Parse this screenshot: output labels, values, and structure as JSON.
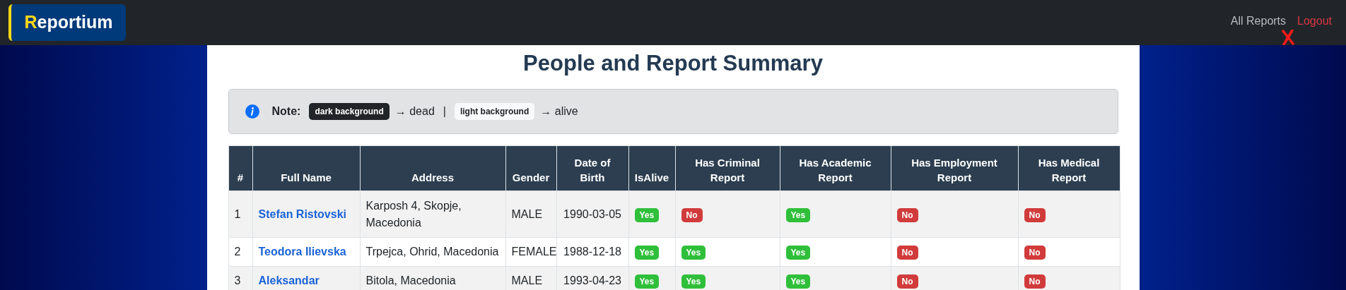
{
  "navbar": {
    "logo_first": "R",
    "logo_rest": "eportium",
    "links": [
      {
        "label": "All Reports",
        "kind": "normal"
      },
      {
        "label": "Logout",
        "kind": "danger"
      }
    ]
  },
  "title": "People and Report Summary",
  "note": {
    "label": "Note:",
    "dark_badge": "dark background",
    "dark_meaning": "→ dead",
    "separator": "|",
    "light_badge": "light background",
    "light_meaning": "→ alive"
  },
  "table": {
    "columns": [
      "#",
      "Full Name",
      "Address",
      "Gender",
      "Date of Birth",
      "IsAlive",
      "Has Criminal Report",
      "Has Academic Report",
      "Has Employment Report",
      "Has Medical Report"
    ],
    "rows": [
      {
        "index": "1",
        "name": "Stefan Ristovski",
        "address": "Karposh 4, Skopje, Macedonia",
        "gender": "MALE",
        "dob": "1990-03-05",
        "flags": [
          {
            "label": "Yes",
            "positive": true
          },
          {
            "label": "No",
            "positive": false
          },
          {
            "label": "Yes",
            "positive": true
          },
          {
            "label": "No",
            "positive": false
          },
          {
            "label": "No",
            "positive": false
          }
        ]
      },
      {
        "index": "2",
        "name": "Teodora Ilievska",
        "address": "Trpejca, Ohrid, Macedonia",
        "gender": "FEMALE",
        "dob": "1988-12-18",
        "flags": [
          {
            "label": "Yes",
            "positive": true
          },
          {
            "label": "Yes",
            "positive": true
          },
          {
            "label": "Yes",
            "positive": true
          },
          {
            "label": "No",
            "positive": false
          },
          {
            "label": "No",
            "positive": false
          }
        ]
      },
      {
        "index": "3",
        "name": "Aleksandar",
        "address": "Bitola, Macedonia",
        "gender": "MALE",
        "dob": "1993-04-23",
        "flags": [
          {
            "label": "Yes",
            "positive": true
          },
          {
            "label": "Yes",
            "positive": true
          },
          {
            "label": "Yes",
            "positive": true
          },
          {
            "label": "No",
            "positive": false
          },
          {
            "label": "No",
            "positive": false
          }
        ]
      }
    ]
  }
}
